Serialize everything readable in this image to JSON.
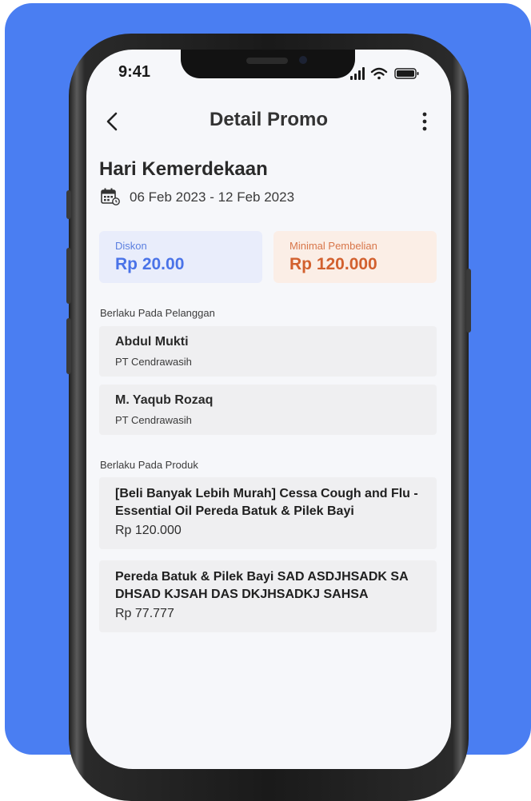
{
  "status": {
    "time": "9:41"
  },
  "header": {
    "title": "Detail Promo"
  },
  "promo": {
    "title": "Hari Kemerdekaan",
    "date_range": "06 Feb 2023 - 12 Feb 2023",
    "discount": {
      "label": "Diskon",
      "value": "Rp 20.00"
    },
    "min_purchase": {
      "label": "Minimal Pembelian",
      "value": "Rp 120.000"
    }
  },
  "customers": {
    "section_label": "Berlaku Pada Pelanggan",
    "items": [
      {
        "name": "Abdul Mukti",
        "company": "PT Cendrawasih"
      },
      {
        "name": "M. Yaqub Rozaq",
        "company": "PT Cendrawasih"
      }
    ]
  },
  "products": {
    "section_label": "Berlaku Pada Produk",
    "items": [
      {
        "name": "[Beli Banyak Lebih Murah] Cessa Cough and Flu - Essential Oil Pereda Batuk & Pilek Bayi",
        "price": "Rp 120.000"
      },
      {
        "name": "Pereda Batuk & Pilek Bayi SAD ASDJHSADK SA DHSAD KJSAH DAS DKJHSADKJ SAHSA",
        "price": "Rp 77.777"
      }
    ]
  },
  "colors": {
    "background": "#4a7ef2",
    "discount_accent": "#4a7ef2",
    "min_purchase_accent": "#d2602e"
  },
  "icons": {
    "back": "chevron-left-icon",
    "more": "more-vertical-icon",
    "date": "calendar-icon"
  }
}
